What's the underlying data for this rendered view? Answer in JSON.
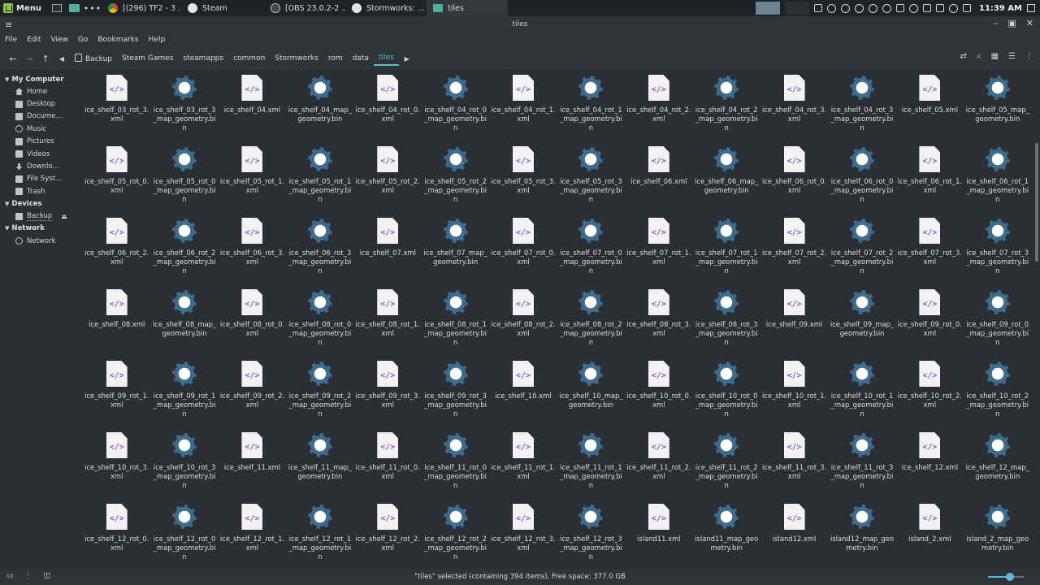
{
  "taskbar": {
    "menu_label": "Menu",
    "tasks": [
      {
        "label": "[(296) TF2 - 3 ...",
        "icon": "chrome-icon"
      },
      {
        "label": "Steam",
        "icon": "steam-icon"
      },
      {
        "label": "[OBS 23.0.2-2 ...",
        "icon": "obs-icon"
      },
      {
        "label": "Stormworks: ...",
        "icon": "steam-icon"
      },
      {
        "label": "tiles",
        "icon": "folder-icon"
      }
    ],
    "clock": "11:39 AM"
  },
  "window": {
    "title": "tiles"
  },
  "menubar": [
    "File",
    "Edit",
    "View",
    "Go",
    "Bookmarks",
    "Help"
  ],
  "breadcrumbs": [
    "Backup",
    "Steam Games",
    "steamapps",
    "common",
    "Stormworks",
    "rom",
    "data",
    "tiles"
  ],
  "sidebar": {
    "sections": [
      {
        "title": "My Computer",
        "items": [
          {
            "label": "Home",
            "icon": "home-icon"
          },
          {
            "label": "Desktop",
            "icon": "desktop-icon"
          },
          {
            "label": "Docume...",
            "icon": "documents-icon"
          },
          {
            "label": "Music",
            "icon": "music-icon"
          },
          {
            "label": "Pictures",
            "icon": "pictures-icon"
          },
          {
            "label": "Videos",
            "icon": "videos-icon"
          },
          {
            "label": "Downlo...",
            "icon": "downloads-icon"
          },
          {
            "label": "File Syst...",
            "icon": "filesystem-icon"
          },
          {
            "label": "Trash",
            "icon": "trash-icon"
          }
        ]
      },
      {
        "title": "Devices",
        "items": [
          {
            "label": "Backup",
            "icon": "drive-icon"
          }
        ]
      },
      {
        "title": "Network",
        "items": [
          {
            "label": "Network",
            "icon": "network-icon"
          }
        ]
      }
    ]
  },
  "files": [
    {
      "name": "ice_shelf_03_rot_3.xml",
      "type": "xml"
    },
    {
      "name": "ice_shelf_03_rot_3_map_geometry.bin",
      "type": "bin"
    },
    {
      "name": "ice_shelf_04.xml",
      "type": "xml"
    },
    {
      "name": "ice_shelf_04_map_geometry.bin",
      "type": "bin"
    },
    {
      "name": "ice_shelf_04_rot_0.xml",
      "type": "xml"
    },
    {
      "name": "ice_shelf_04_rot_0_map_geometry.bin",
      "type": "bin"
    },
    {
      "name": "ice_shelf_04_rot_1.xml",
      "type": "xml"
    },
    {
      "name": "ice_shelf_04_rot_1_map_geometry.bin",
      "type": "bin"
    },
    {
      "name": "ice_shelf_04_rot_2.xml",
      "type": "xml"
    },
    {
      "name": "ice_shelf_04_rot_2_map_geometry.bin",
      "type": "bin"
    },
    {
      "name": "ice_shelf_04_rot_3.xml",
      "type": "xml"
    },
    {
      "name": "ice_shelf_04_rot_3_map_geometry.bin",
      "type": "bin"
    },
    {
      "name": "ice_shelf_05.xml",
      "type": "xml"
    },
    {
      "name": "ice_shelf_05_map_geometry.bin",
      "type": "bin"
    },
    {
      "name": "ice_shelf_05_rot_0.xml",
      "type": "xml"
    },
    {
      "name": "ice_shelf_05_rot_0_map_geometry.bin",
      "type": "bin"
    },
    {
      "name": "ice_shelf_05_rot_1.xml",
      "type": "xml"
    },
    {
      "name": "ice_shelf_05_rot_1_map_geometry.bin",
      "type": "bin"
    },
    {
      "name": "ice_shelf_05_rot_2.xml",
      "type": "xml"
    },
    {
      "name": "ice_shelf_05_rot_2_map_geometry.bin",
      "type": "bin"
    },
    {
      "name": "ice_shelf_05_rot_3.xml",
      "type": "xml"
    },
    {
      "name": "ice_shelf_05_rot_3_map_geometry.bin",
      "type": "bin"
    },
    {
      "name": "ice_shelf_06.xml",
      "type": "xml"
    },
    {
      "name": "ice_shelf_06_map_geometry.bin",
      "type": "bin"
    },
    {
      "name": "ice_shelf_06_rot_0.xml",
      "type": "xml"
    },
    {
      "name": "ice_shelf_06_rot_0_map_geometry.bin",
      "type": "bin"
    },
    {
      "name": "ice_shelf_06_rot_1.xml",
      "type": "xml"
    },
    {
      "name": "ice_shelf_06_rot_1_map_geometry.bin",
      "type": "bin"
    },
    {
      "name": "ice_shelf_06_rot_2.xml",
      "type": "xml"
    },
    {
      "name": "ice_shelf_06_rot_2_map_geometry.bin",
      "type": "bin"
    },
    {
      "name": "ice_shelf_06_rot_3.xml",
      "type": "xml"
    },
    {
      "name": "ice_shelf_06_rot_3_map_geometry.bin",
      "type": "bin"
    },
    {
      "name": "ice_shelf_07.xml",
      "type": "xml"
    },
    {
      "name": "ice_shelf_07_map_geometry.bin",
      "type": "bin"
    },
    {
      "name": "ice_shelf_07_rot_0.xml",
      "type": "xml"
    },
    {
      "name": "ice_shelf_07_rot_0_map_geometry.bin",
      "type": "bin"
    },
    {
      "name": "ice_shelf_07_rot_1.xml",
      "type": "xml"
    },
    {
      "name": "ice_shelf_07_rot_1_map_geometry.bin",
      "type": "bin"
    },
    {
      "name": "ice_shelf_07_rot_2.xml",
      "type": "xml"
    },
    {
      "name": "ice_shelf_07_rot_2_map_geometry.bin",
      "type": "bin"
    },
    {
      "name": "ice_shelf_07_rot_3.xml",
      "type": "xml"
    },
    {
      "name": "ice_shelf_07_rot_3_map_geometry.bin",
      "type": "bin"
    },
    {
      "name": "ice_shelf_08.xml",
      "type": "xml"
    },
    {
      "name": "ice_shelf_08_map_geometry.bin",
      "type": "bin"
    },
    {
      "name": "ice_shelf_08_rot_0.xml",
      "type": "xml"
    },
    {
      "name": "ice_shelf_08_rot_0_map_geometry.bin",
      "type": "bin"
    },
    {
      "name": "ice_shelf_08_rot_1.xml",
      "type": "xml"
    },
    {
      "name": "ice_shelf_08_rot_1_map_geometry.bin",
      "type": "bin"
    },
    {
      "name": "ice_shelf_08_rot_2.xml",
      "type": "xml"
    },
    {
      "name": "ice_shelf_08_rot_2_map_geometry.bin",
      "type": "bin"
    },
    {
      "name": "ice_shelf_08_rot_3.xml",
      "type": "xml"
    },
    {
      "name": "ice_shelf_08_rot_3_map_geometry.bin",
      "type": "bin"
    },
    {
      "name": "ice_shelf_09.xml",
      "type": "xml"
    },
    {
      "name": "ice_shelf_09_map_geometry.bin",
      "type": "bin"
    },
    {
      "name": "ice_shelf_09_rot_0.xml",
      "type": "xml"
    },
    {
      "name": "ice_shelf_09_rot_0_map_geometry.bin",
      "type": "bin"
    },
    {
      "name": "ice_shelf_09_rot_1.xml",
      "type": "xml"
    },
    {
      "name": "ice_shelf_09_rot_1_map_geometry.bin",
      "type": "bin"
    },
    {
      "name": "ice_shelf_09_rot_2.xml",
      "type": "xml"
    },
    {
      "name": "ice_shelf_09_rot_2_map_geometry.bin",
      "type": "bin"
    },
    {
      "name": "ice_shelf_09_rot_3.xml",
      "type": "xml"
    },
    {
      "name": "ice_shelf_09_rot_3_map_geometry.bin",
      "type": "bin"
    },
    {
      "name": "ice_shelf_10.xml",
      "type": "xml"
    },
    {
      "name": "ice_shelf_10_map_geometry.bin",
      "type": "bin"
    },
    {
      "name": "ice_shelf_10_rot_0.xml",
      "type": "xml"
    },
    {
      "name": "ice_shelf_10_rot_0_map_geometry.bin",
      "type": "bin"
    },
    {
      "name": "ice_shelf_10_rot_1.xml",
      "type": "xml"
    },
    {
      "name": "ice_shelf_10_rot_1_map_geometry.bin",
      "type": "bin"
    },
    {
      "name": "ice_shelf_10_rot_2.xml",
      "type": "xml"
    },
    {
      "name": "ice_shelf_10_rot_2_map_geometry.bin",
      "type": "bin"
    },
    {
      "name": "ice_shelf_10_rot_3.xml",
      "type": "xml"
    },
    {
      "name": "ice_shelf_10_rot_3_map_geometry.bin",
      "type": "bin"
    },
    {
      "name": "ice_shelf_11.xml",
      "type": "xml"
    },
    {
      "name": "ice_shelf_11_map_geometry.bin",
      "type": "bin"
    },
    {
      "name": "ice_shelf_11_rot_0.xml",
      "type": "xml"
    },
    {
      "name": "ice_shelf_11_rot_0_map_geometry.bin",
      "type": "bin"
    },
    {
      "name": "ice_shelf_11_rot_1.xml",
      "type": "xml"
    },
    {
      "name": "ice_shelf_11_rot_1_map_geometry.bin",
      "type": "bin"
    },
    {
      "name": "ice_shelf_11_rot_2.xml",
      "type": "xml"
    },
    {
      "name": "ice_shelf_11_rot_2_map_geometry.bin",
      "type": "bin"
    },
    {
      "name": "ice_shelf_11_rot_3.xml",
      "type": "xml"
    },
    {
      "name": "ice_shelf_11_rot_3_map_geometry.bin",
      "type": "bin"
    },
    {
      "name": "ice_shelf_12.xml",
      "type": "xml"
    },
    {
      "name": "ice_shelf_12_map_geometry.bin",
      "type": "bin"
    },
    {
      "name": "ice_shelf_12_rot_0.xml",
      "type": "xml"
    },
    {
      "name": "ice_shelf_12_rot_0_map_geometry.bin",
      "type": "bin"
    },
    {
      "name": "ice_shelf_12_rot_1.xml",
      "type": "xml"
    },
    {
      "name": "ice_shelf_12_rot_1_map_geometry.bin",
      "type": "bin"
    },
    {
      "name": "ice_shelf_12_rot_2.xml",
      "type": "xml"
    },
    {
      "name": "ice_shelf_12_rot_2_map_geometry.bin",
      "type": "bin"
    },
    {
      "name": "ice_shelf_12_rot_3.xml",
      "type": "xml"
    },
    {
      "name": "ice_shelf_12_rot_3_map_geometry.bin",
      "type": "bin"
    },
    {
      "name": "island11.xml",
      "type": "xml"
    },
    {
      "name": "island11_map_geometry.bin",
      "type": "bin"
    },
    {
      "name": "island12.xml",
      "type": "xml"
    },
    {
      "name": "island12_map_geometry.bin",
      "type": "bin"
    },
    {
      "name": "island_2.xml",
      "type": "xml"
    },
    {
      "name": "island_2_map_geometry.bin",
      "type": "bin"
    }
  ],
  "status": {
    "text": "\"tiles\" selected (containing 394 items), Free space: 377.0 GB"
  },
  "zoom_level": 0.62,
  "colors": {
    "accent": "#5bbcd8",
    "xml_icon": "#8e58c9",
    "bin_icon": "#3d6c8e"
  }
}
